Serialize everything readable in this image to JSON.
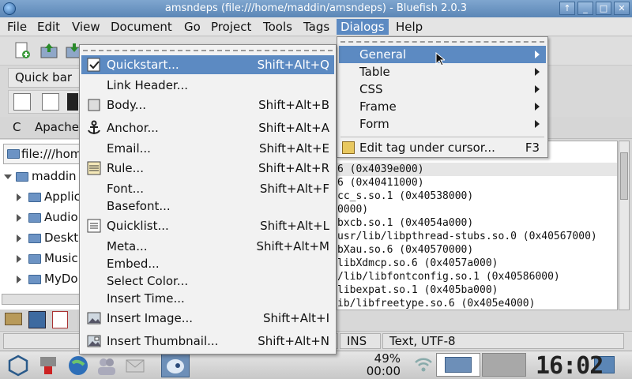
{
  "window": {
    "title": "amsndeps (file:///home/maddin/amsndeps) - Bluefish 2.0.3",
    "buttons": [
      "↑",
      "_",
      "□",
      "✕"
    ]
  },
  "menubar": [
    "File",
    "Edit",
    "View",
    "Document",
    "Go",
    "Project",
    "Tools",
    "Tags",
    "Dialogs",
    "Help"
  ],
  "quickbar": {
    "tab_label": "Quick bar"
  },
  "html_tabs": [
    "C",
    "Apache"
  ],
  "filebrowser": {
    "path": "file:///home/maddin",
    "root": "maddin",
    "items": [
      "Applic",
      "Audio",
      "Deskt",
      "Music",
      "MyDo"
    ]
  },
  "dialogs_menu": {
    "items": [
      {
        "label": "General",
        "submenu": true
      },
      {
        "label": "Table",
        "submenu": true
      },
      {
        "label": "CSS",
        "submenu": true
      },
      {
        "label": "Frame",
        "submenu": true
      },
      {
        "label": "Form",
        "submenu": true
      },
      {
        "label": "Edit tag under cursor...",
        "accel": "F3"
      }
    ]
  },
  "general_menu": {
    "items": [
      {
        "label": "Quickstart...",
        "accel": "Shift+Alt+Q",
        "icon": "quickstart-icon"
      },
      {
        "label": "Link Header...",
        "accel": "",
        "icon": ""
      },
      {
        "label": "Body...",
        "accel": "Shift+Alt+B",
        "icon": "body-icon"
      },
      {
        "label": "Anchor...",
        "accel": "Shift+Alt+A",
        "icon": "anchor-icon"
      },
      {
        "label": "Email...",
        "accel": "Shift+Alt+E",
        "icon": ""
      },
      {
        "label": "Rule...",
        "accel": "Shift+Alt+R",
        "icon": "rule-icon"
      },
      {
        "label": "Font...",
        "accel": "Shift+Alt+F",
        "icon": ""
      },
      {
        "label": "Basefont...",
        "accel": "",
        "icon": ""
      },
      {
        "label": "Quicklist...",
        "accel": "Shift+Alt+L",
        "icon": "quicklist-icon"
      },
      {
        "label": "Meta...",
        "accel": "Shift+Alt+M",
        "icon": ""
      },
      {
        "label": "Embed...",
        "accel": "",
        "icon": ""
      },
      {
        "label": "Select Color...",
        "accel": "",
        "icon": ""
      },
      {
        "label": "Insert Time...",
        "accel": "",
        "icon": ""
      },
      {
        "label": "Insert Image...",
        "accel": "Shift+Alt+I",
        "icon": "image-icon"
      },
      {
        "label": "Insert Thumbnail...",
        "accel": "Shift+Alt+N",
        "icon": "thumbnail-icon"
      }
    ]
  },
  "editor_lines": [
    "6 (0x4039e000)",
    "6 (0x40411000)",
    "cc_s.so.1 (0x40538000)",
    "0000)",
    "bxcb.so.1 (0x4054a000)",
    "usr/lib/libpthread-stubs.so.0 (0x40567000)",
    "bXau.so.6 (0x40570000)",
    "libXdmcp.so.6 (0x4057a000)",
    "/lib/libfontconfig.so.1 (0x40586000)",
    "libexpat.so.1 (0x405ba000)",
    "ib/libfreetype.so.6 (0x405e4000)"
  ],
  "statusbar": {
    "mode": "INS",
    "encoding": "Text, UTF-8"
  },
  "taskbar": {
    "battery_percent": "49%",
    "battery_time": "00:00",
    "clock": "16:02"
  },
  "colors": {
    "accent": "#5c8ac2",
    "titlebar": "#6f97c4"
  }
}
